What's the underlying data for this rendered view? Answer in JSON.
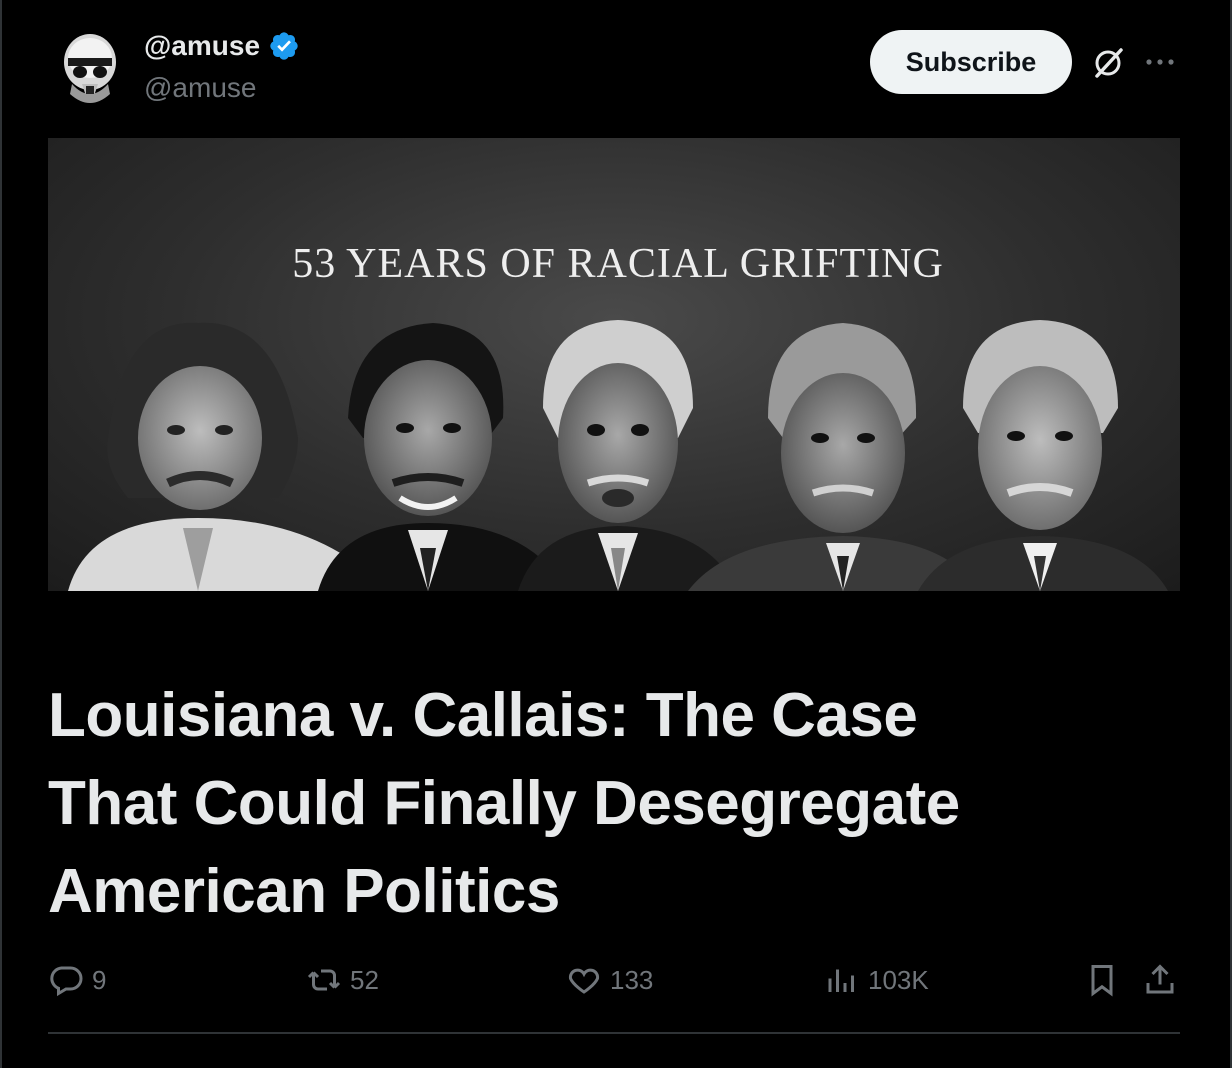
{
  "author": {
    "display_name": "@amuse",
    "handle": "@amuse",
    "verified": true,
    "avatar_icon": "stormtrooper-avatar"
  },
  "header": {
    "subscribe_label": "Subscribe",
    "grok_icon": "slashed-circle-icon",
    "more_icon": "more-icon"
  },
  "banner": {
    "title": "53 YEARS OF RACIAL GRIFTING",
    "portrait_count": 5
  },
  "article": {
    "title_lines": [
      "Louisiana v. Callais: The Case",
      "That Could Finally Desegregate",
      "American Politics"
    ]
  },
  "actions": {
    "replies": "9",
    "reposts": "52",
    "likes": "133",
    "views": "103K"
  },
  "colors": {
    "background": "#000000",
    "text_primary": "#e7e9ea",
    "text_secondary": "#71767b",
    "verified_blue": "#1d9bf0",
    "button_bg": "#eff3f4"
  }
}
